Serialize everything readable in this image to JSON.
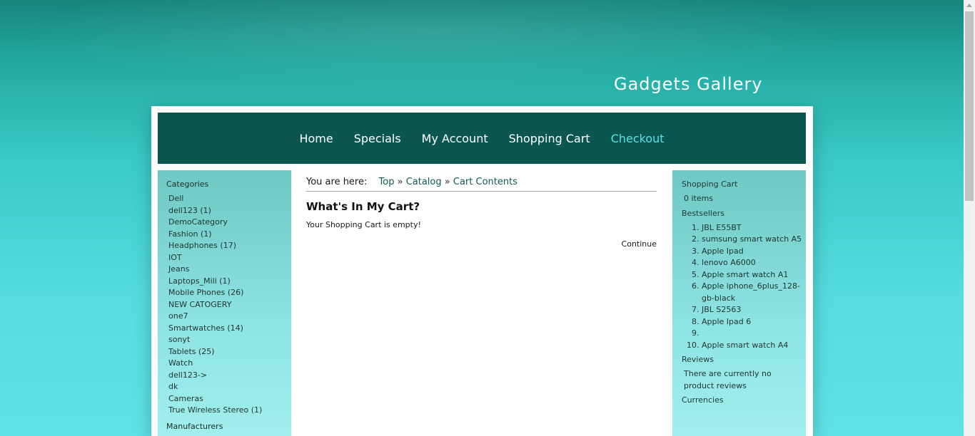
{
  "site": {
    "title": "Gadgets Gallery"
  },
  "nav": [
    {
      "label": "Home"
    },
    {
      "label": "Specials"
    },
    {
      "label": "My Account"
    },
    {
      "label": "Shopping Cart"
    },
    {
      "label": "Checkout"
    }
  ],
  "categories": {
    "heading": "Categories",
    "items": [
      "Dell",
      "dell123 (1)",
      "DemoCategory",
      "Fashion (1)",
      "Headphones (17)",
      "IOT",
      "Jeans",
      "Laptops_Mili (1)",
      "Mobile Phones (26)",
      "NEW CATOGERY",
      "one7",
      "Smartwatches (14)",
      "sonyt",
      "Tablets (25)",
      "Watch",
      "dell123->",
      "dk",
      "Cameras",
      "True Wireless Stereo (1)"
    ]
  },
  "manufacturers": {
    "heading": "Manufacturers"
  },
  "breadcrumb": {
    "label": "You are here:",
    "items": [
      "Top",
      "Catalog",
      "Cart Contents"
    ],
    "separator": "»"
  },
  "main": {
    "title": "What's In My Cart?",
    "message": "Your Shopping Cart is empty!",
    "continue": "Continue"
  },
  "cart": {
    "heading": "Shopping Cart",
    "items": "0 items"
  },
  "bestsellers": {
    "heading": "Bestsellers",
    "items": [
      "JBL E55BT",
      "sumsung smart watch A5",
      "Apple Ipad",
      "lenovo A6000",
      "Apple smart watch A1",
      "Apple iphone_6plus_128-gb-black",
      "JBL S2563",
      "Apple Ipad 6",
      "",
      "Apple smart watch A4"
    ]
  },
  "reviews": {
    "heading": "Reviews",
    "text": "There are currently no product reviews"
  },
  "currencies": {
    "heading": "Currencies"
  },
  "colors": {
    "nav_bg": "#0b5651",
    "nav_active": "#5be2e3",
    "link": "#0f5a55"
  }
}
